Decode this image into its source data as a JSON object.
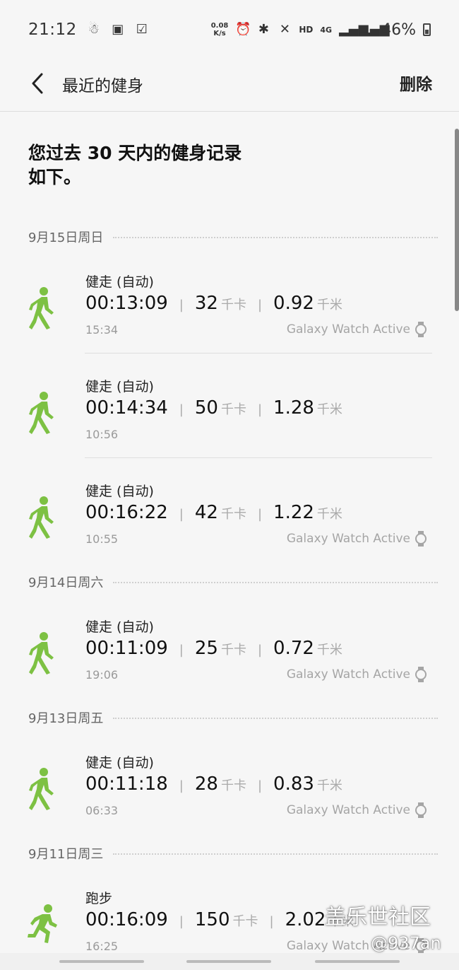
{
  "status_bar": {
    "time": "21:12",
    "net_speed_value": "0.08",
    "net_speed_unit": "K/s",
    "hd": "HD",
    "network": "4G",
    "battery": "46%"
  },
  "app_bar": {
    "title": "最近的健身",
    "delete_label": "删除"
  },
  "intro": "您过去 30 天内的健身记录\n如下。",
  "groups": [
    {
      "date": "9月15日周日",
      "records": [
        {
          "type": "健走 (自动)",
          "duration": "00:13:09",
          "calories": "32",
          "calories_unit": "千卡",
          "distance": "0.92",
          "distance_unit": "千米",
          "time": "15:34",
          "device": "Galaxy Watch Active"
        },
        {
          "type": "健走 (自动)",
          "duration": "00:14:34",
          "calories": "50",
          "calories_unit": "千卡",
          "distance": "1.28",
          "distance_unit": "千米",
          "time": "10:56",
          "device": ""
        },
        {
          "type": "健走 (自动)",
          "duration": "00:16:22",
          "calories": "42",
          "calories_unit": "千卡",
          "distance": "1.22",
          "distance_unit": "千米",
          "time": "10:55",
          "device": "Galaxy Watch Active"
        }
      ]
    },
    {
      "date": "9月14日周六",
      "records": [
        {
          "type": "健走 (自动)",
          "duration": "00:11:09",
          "calories": "25",
          "calories_unit": "千卡",
          "distance": "0.72",
          "distance_unit": "千米",
          "time": "19:06",
          "device": "Galaxy Watch Active"
        }
      ]
    },
    {
      "date": "9月13日周五",
      "records": [
        {
          "type": "健走 (自动)",
          "duration": "00:11:18",
          "calories": "28",
          "calories_unit": "千卡",
          "distance": "0.83",
          "distance_unit": "千米",
          "time": "06:33",
          "device": "Galaxy Watch Active"
        }
      ]
    },
    {
      "date": "9月11日周三",
      "records": [
        {
          "type": "跑步",
          "duration": "00:16:09",
          "calories": "150",
          "calories_unit": "千卡",
          "distance": "2.02",
          "distance_unit": "千米",
          "time": "16:25",
          "device": "Galaxy Watch Active"
        }
      ]
    }
  ],
  "watermark": {
    "line1": "盖乐世社区",
    "line2": "@937an"
  },
  "colors": {
    "activity_green": "#7dc143",
    "divider": "#dedede"
  }
}
